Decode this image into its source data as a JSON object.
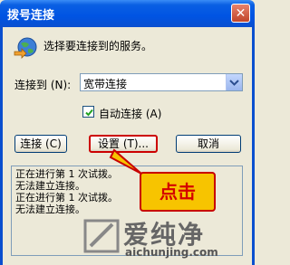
{
  "window": {
    "title": "拨号连接",
    "close_glyph": "✕"
  },
  "dialog": {
    "prompt": "选择要连接到的服务。",
    "connect_to_label": "连接到 (N):",
    "connection_value": "宽带连接",
    "auto_connect_label": "自动连接 (A)",
    "auto_connect_checked": true
  },
  "buttons": {
    "connect": "连接 (C)",
    "settings": "设置 (T)...",
    "cancel": "取消"
  },
  "log": [
    "正在进行第 1 次试拨。",
    "无法建立连接。",
    "正在进行第 1 次试拨。",
    "无法建立连接。"
  ],
  "annotation": {
    "text": "点击",
    "color": "#d40000",
    "bg": "#f7c400"
  },
  "watermark": {
    "brand": "爱纯净",
    "url": "aichunjing.com"
  },
  "icons": [
    "globe-connection-icon",
    "dropdown-arrow-icon",
    "checkmark-icon",
    "close-icon"
  ]
}
